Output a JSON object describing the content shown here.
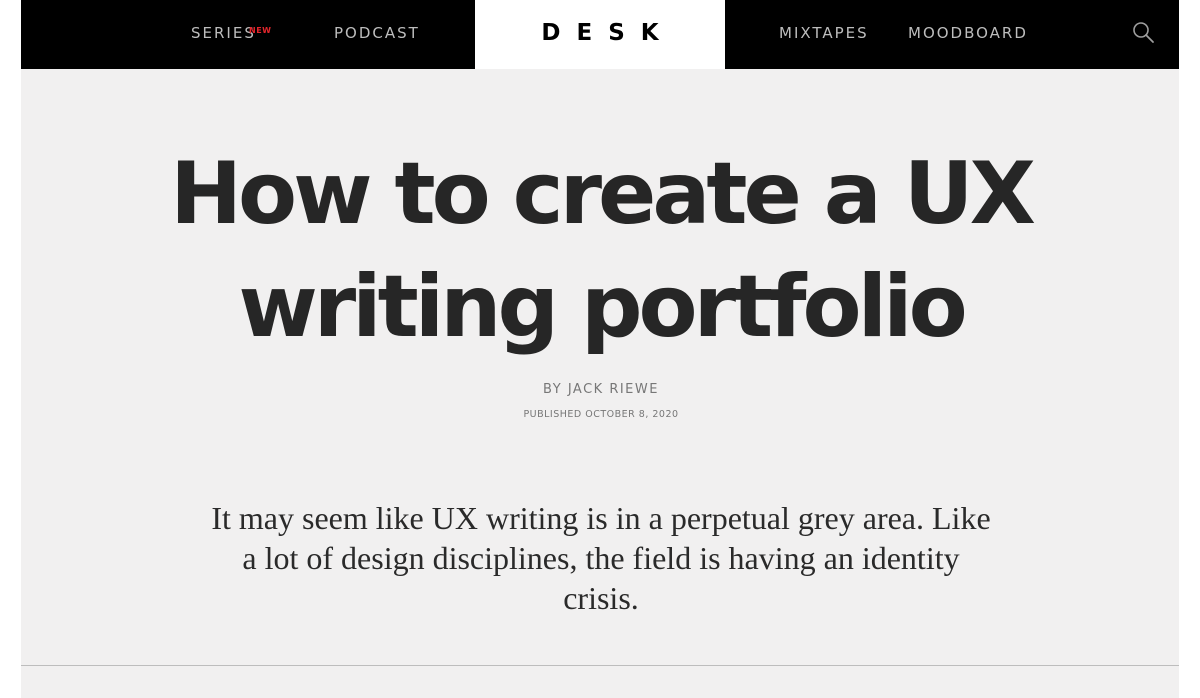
{
  "nav": {
    "series_label": "SERIES",
    "series_badge": "NEW",
    "podcast_label": "PODCAST",
    "logo": "DESK",
    "mixtapes_label": "MIXTAPES",
    "moodboard_label": "MOODBOARD",
    "search_icon": "search-icon"
  },
  "article": {
    "title": "How to create a UX writing portfolio",
    "byline_prefix": "BY",
    "author": "JACK RIEWE",
    "published": "PUBLISHED OCTOBER 8, 2020",
    "dek": "It may seem like UX writing is in a perpetual grey area. Like a lot of design disciplines, the field is having an identity crisis."
  },
  "colors": {
    "nav_background": "#000000",
    "nav_text": "#bdbdbd",
    "badge": "#e3262c",
    "page_background": "#f1f0f0",
    "title_text": "#262626"
  }
}
